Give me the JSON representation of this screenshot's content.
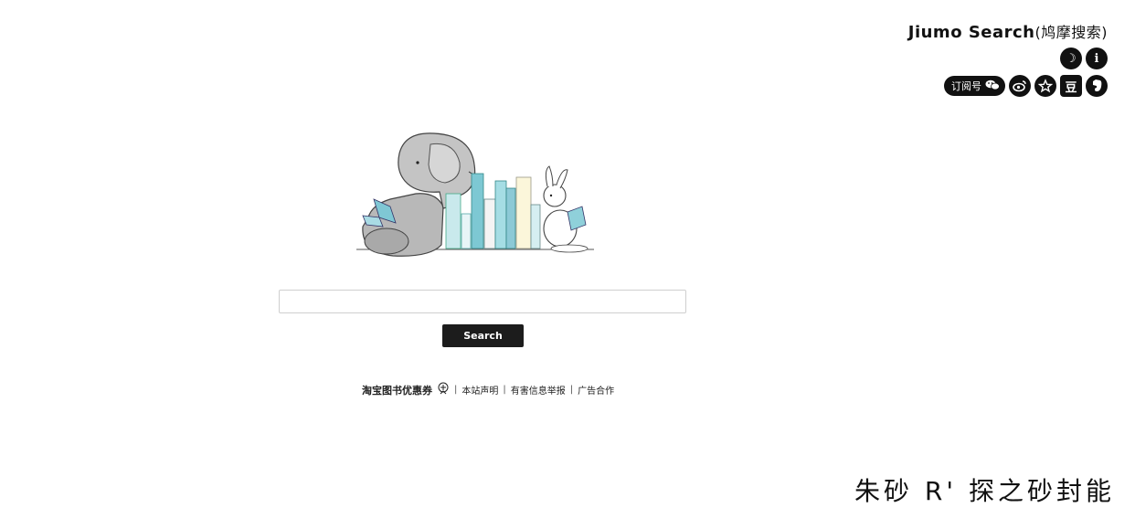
{
  "header": {
    "brand": "Jiumo Search",
    "brand_sub": "(鸠摩搜索)"
  },
  "icons_row1": [
    {
      "name": "moon-icon",
      "glyph": "☽"
    },
    {
      "name": "info-icon",
      "glyph": "i"
    }
  ],
  "icons_row2": {
    "subscribe_label": "订阅号",
    "subscribe_icon": "wechat-icon",
    "icons": [
      {
        "name": "weibo-icon",
        "glyph": "◉"
      },
      {
        "name": "star-icon",
        "glyph": "★"
      },
      {
        "name": "douban-icon",
        "glyph": "豆"
      },
      {
        "name": "evernote-icon",
        "glyph": "❦"
      }
    ]
  },
  "search": {
    "value": "",
    "button_label": "Search"
  },
  "footer": {
    "coupon_label": "淘宝图书优惠券",
    "coupon_icon": "gift-icon",
    "links": [
      "本站声明",
      "有害信息举报",
      "广告合作"
    ],
    "separator": "|"
  },
  "bottom_text": "朱砂 R' 探之砂封能"
}
